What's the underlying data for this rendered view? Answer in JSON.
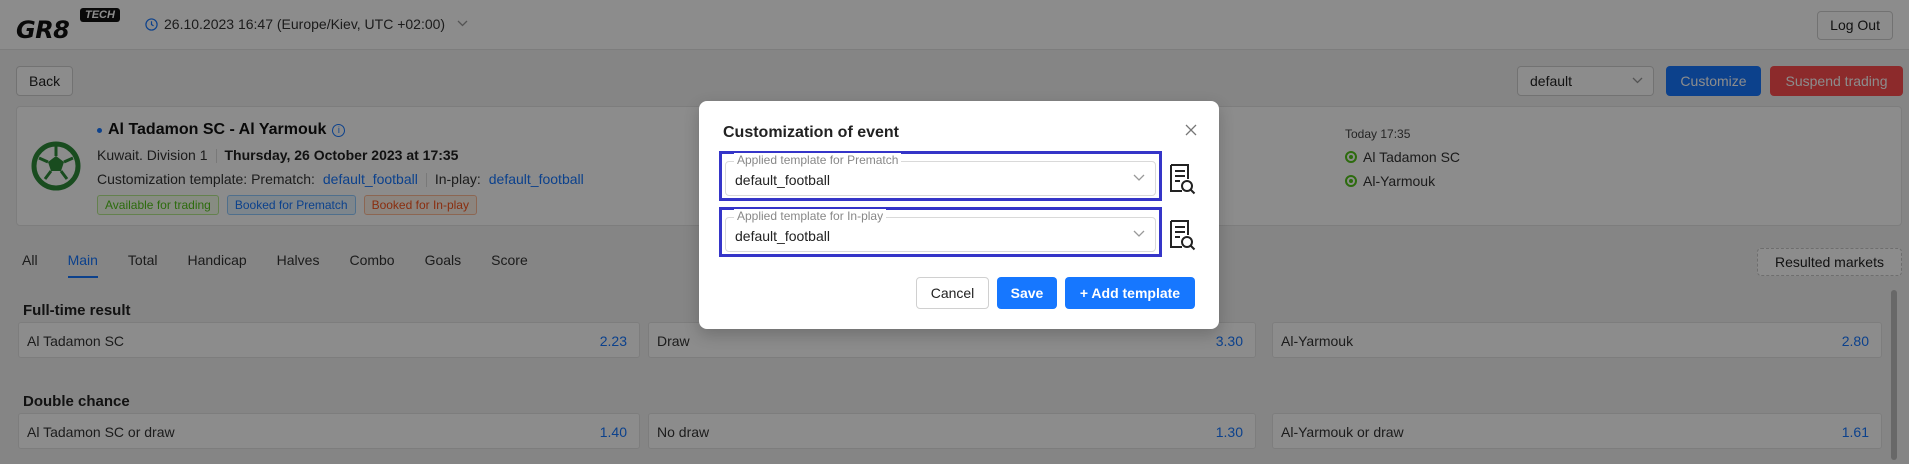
{
  "header": {
    "logo_main": "GR8",
    "logo_tag": "TECH",
    "datetime": "26.10.2023 16:47 (Europe/Kiev, UTC +02:00)",
    "logout_label": "Log Out"
  },
  "toolbar": {
    "back_label": "Back",
    "select_value": "default",
    "customize_label": "Customize",
    "suspend_label": "Suspend trading"
  },
  "event": {
    "title": "Al Tadamon SC - Al Yarmouk",
    "league": "Kuwait. Division 1",
    "date": "Thursday, 26 October 2023 at 17:35",
    "template_prefix": "Customization template: Prematch:",
    "prematch_template": "default_football",
    "inplay_prefix": "In-play:",
    "inplay_template": "default_football",
    "tags": [
      "Available for trading",
      "Booked for Prematch",
      "Booked for In-play"
    ],
    "start_time": "Today 17:35",
    "team_home": "Al Tadamon SC",
    "team_away": "Al-Yarmouk"
  },
  "tabs": [
    "All",
    "Main",
    "Total",
    "Handicap",
    "Halves",
    "Combo",
    "Goals",
    "Score"
  ],
  "active_tab": "Main",
  "resulted_label": "Resulted markets",
  "markets": [
    {
      "title": "Full-time result",
      "odds": [
        {
          "name": "Al Tadamon SC",
          "value": "2.23"
        },
        {
          "name": "Draw",
          "value": "3.30"
        },
        {
          "name": "Al-Yarmouk",
          "value": "2.80"
        }
      ]
    },
    {
      "title": "Double chance",
      "odds": [
        {
          "name": "Al Tadamon SC or draw",
          "value": "1.40"
        },
        {
          "name": "No draw",
          "value": "1.30"
        },
        {
          "name": "Al-Yarmouk or draw",
          "value": "1.61"
        }
      ]
    }
  ],
  "modal": {
    "title": "Customization of event",
    "prematch_label": "Applied template for Prematch",
    "prematch_value": "default_football",
    "inplay_label": "Applied template for In-play",
    "inplay_value": "default_football",
    "cancel_label": "Cancel",
    "save_label": "Save",
    "add_template_label": "+ Add template"
  },
  "colors": {
    "accent": "#1677ff",
    "danger": "#ff4d4f",
    "highlight_border": "#3535c8"
  }
}
